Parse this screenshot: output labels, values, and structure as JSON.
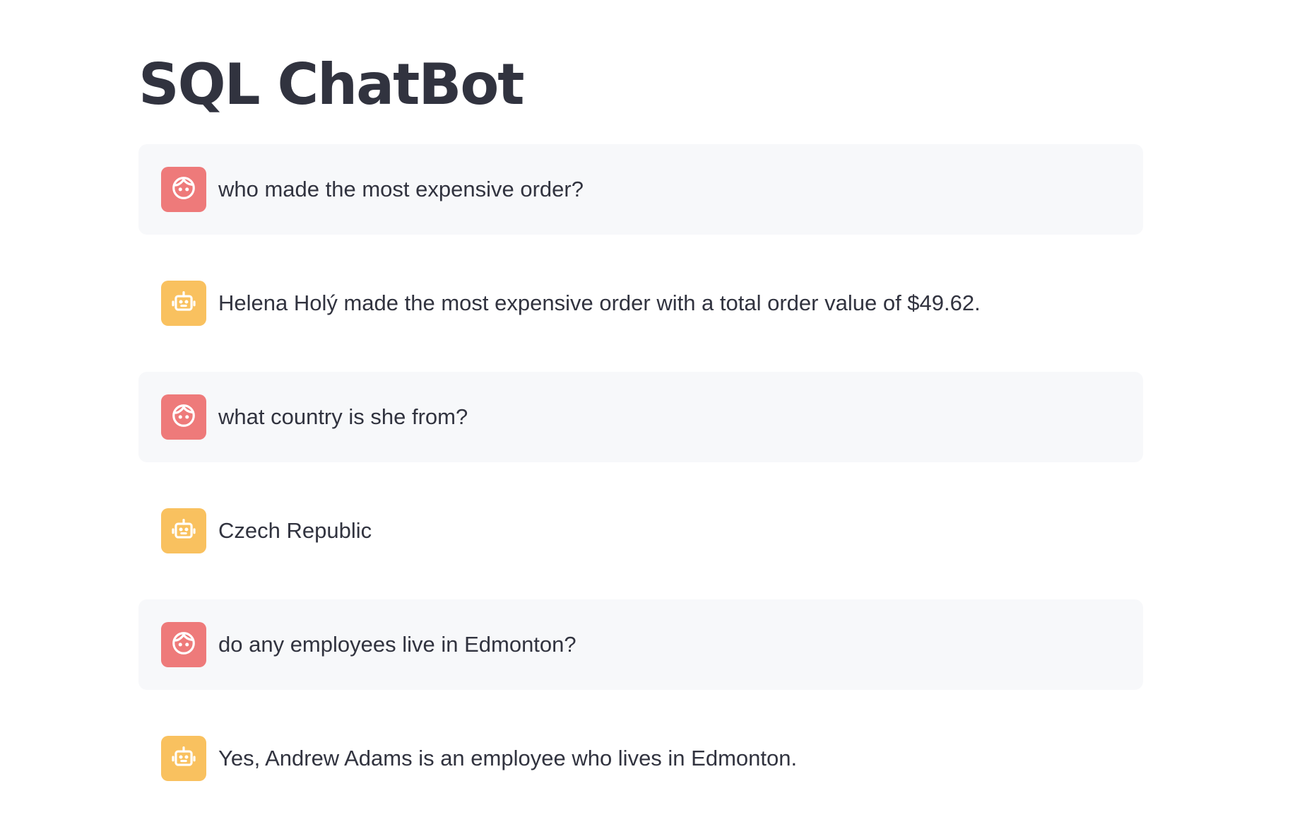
{
  "page": {
    "title": "SQL ChatBot"
  },
  "messages": [
    {
      "role": "user",
      "avatar_icon": "face-icon",
      "text": "who made the most expensive order?"
    },
    {
      "role": "assistant",
      "avatar_icon": "robot-icon",
      "text": "Helena Holý made the most expensive order with a total order value of $49.62."
    },
    {
      "role": "user",
      "avatar_icon": "face-icon",
      "text": "what country is she from?"
    },
    {
      "role": "assistant",
      "avatar_icon": "robot-icon",
      "text": "Czech Republic"
    },
    {
      "role": "user",
      "avatar_icon": "face-icon",
      "text": "do any employees live in Edmonton?"
    },
    {
      "role": "assistant",
      "avatar_icon": "robot-icon",
      "text": "Yes, Andrew Adams is an employee who lives in Edmonton."
    }
  ],
  "colors": {
    "user_avatar": "#ee7a7a",
    "assistant_avatar": "#f9c15f",
    "user_bubble": "#f7f8fa",
    "text": "#31333f"
  }
}
